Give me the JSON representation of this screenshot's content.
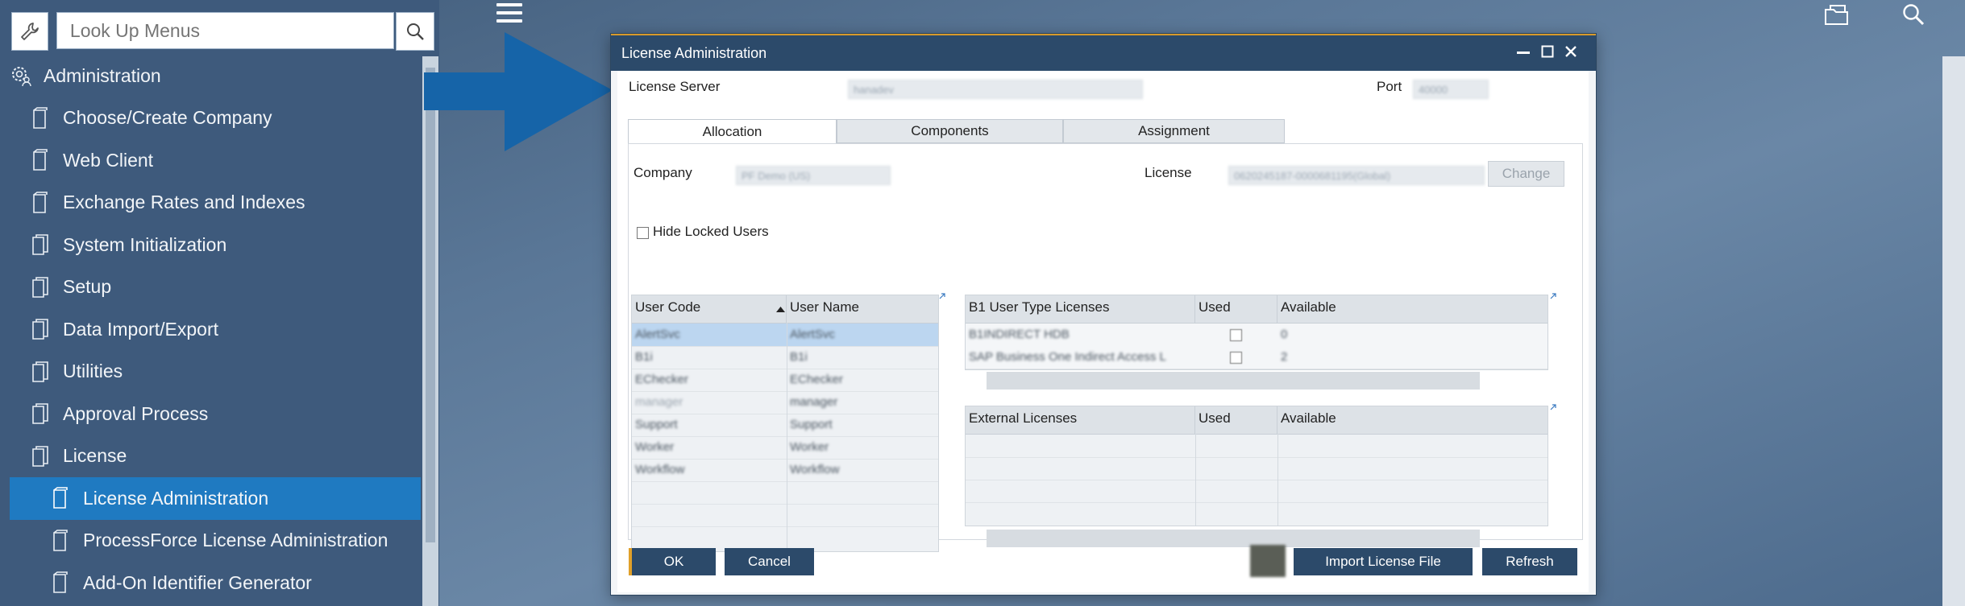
{
  "search": {
    "placeholder": "Look Up Menus"
  },
  "sidebar": {
    "items": [
      {
        "label": "Administration"
      },
      {
        "label": "Choose/Create Company"
      },
      {
        "label": "Web Client"
      },
      {
        "label": "Exchange Rates and Indexes"
      },
      {
        "label": "System Initialization"
      },
      {
        "label": "Setup"
      },
      {
        "label": "Data Import/Export"
      },
      {
        "label": "Utilities"
      },
      {
        "label": "Approval Process"
      },
      {
        "label": "License"
      },
      {
        "label": "License Administration"
      },
      {
        "label": "ProcessForce License Administration"
      },
      {
        "label": "Add-On Identifier Generator"
      }
    ]
  },
  "dialog": {
    "title": "License Administration",
    "license_server_label": "License Server",
    "license_server_value": "hanadev",
    "port_label": "Port",
    "port_value": "40000",
    "tabs": [
      "Allocation",
      "Components",
      "Assignment"
    ],
    "company_label": "Company",
    "company_value": "PF Demo (US)",
    "license_label": "License",
    "license_value": "0620245187-0000681195(Global)",
    "change_label": "Change",
    "hide_locked_label": "Hide Locked Users",
    "users_grid": {
      "headers": [
        "User Code",
        "User Name"
      ],
      "rows": [
        [
          "AlertSvc",
          "AlertSvc"
        ],
        [
          "B1i",
          "B1i"
        ],
        [
          "EChecker",
          "EChecker"
        ],
        [
          "manager",
          "manager"
        ],
        [
          "Support",
          "Support"
        ],
        [
          "Worker",
          "Worker"
        ],
        [
          "Workflow",
          "Workflow"
        ]
      ]
    },
    "b1_grid": {
      "headers": [
        "B1 User Type Licenses",
        "Used",
        "Available"
      ],
      "rows": [
        [
          "B1INDIRECT HDB",
          "0"
        ],
        [
          "SAP Business One Indirect Access L",
          "2"
        ]
      ]
    },
    "ext_grid": {
      "headers": [
        "External Licenses",
        "Used",
        "Available"
      ]
    },
    "buttons": {
      "ok": "OK",
      "cancel": "Cancel",
      "import": "Import License File",
      "refresh": "Refresh"
    }
  },
  "colors": {
    "sidebar_bg": "#3e5a7c",
    "active_item": "#1f7ac1",
    "title_bar": "#2c4a6a",
    "arrow": "#1664a8",
    "accent": "#e0a02a"
  }
}
